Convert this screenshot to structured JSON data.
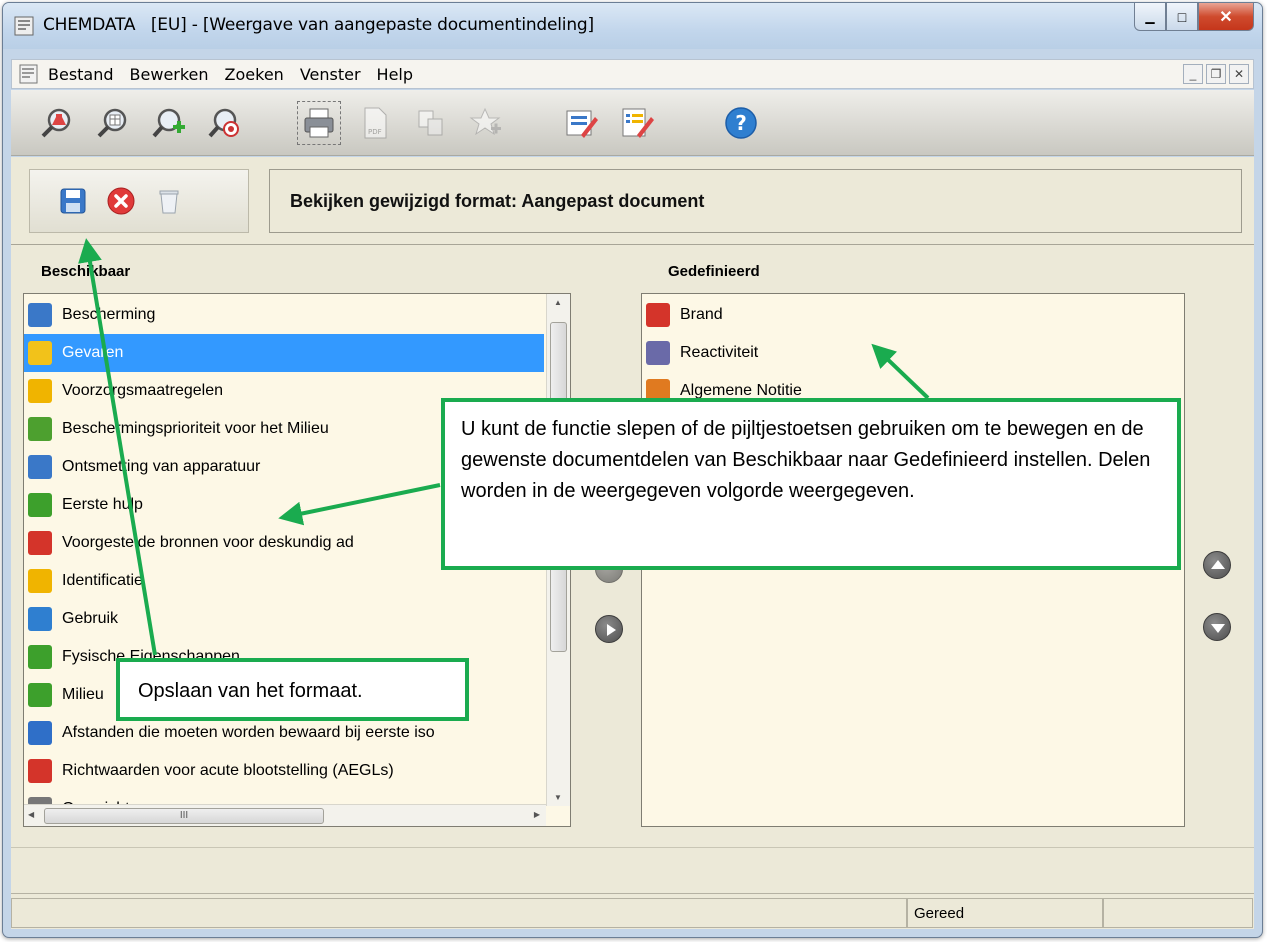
{
  "window": {
    "title": "CHEMDATA   [EU] - [Weergave van aangepaste documentindeling]",
    "minimize_glyph": "▁",
    "maximize_glyph": "□",
    "close_glyph": "✕"
  },
  "menu": {
    "items": [
      "Bestand",
      "Bewerken",
      "Zoeken",
      "Venster",
      "Help"
    ],
    "mdi_min": "_",
    "mdi_restore": "❐",
    "mdi_close": "✕"
  },
  "toolbar": {
    "icons": [
      "search-flask-icon",
      "search-table-icon",
      "search-add-icon",
      "search-target-icon",
      "print-icon",
      "pdf-icon",
      "copy-icon",
      "compare-icon",
      "edit-lock-icon",
      "edit-list-icon",
      "help-icon"
    ],
    "help_glyph": "?"
  },
  "header": {
    "title": "Bekijken gewijzigd format: Aangepast document"
  },
  "available": {
    "title": "Beschikbaar",
    "items": [
      {
        "label": "Bescherming",
        "color": "#3a78c8"
      },
      {
        "label": "Gevaren",
        "color": "#f2c21a"
      },
      {
        "label": "Voorzorgsmaatregelen",
        "color": "#f0b400"
      },
      {
        "label": "Beschermingsprioriteit voor het Milieu",
        "color": "#4da02f"
      },
      {
        "label": "Ontsmetting van apparatuur",
        "color": "#3a78c8"
      },
      {
        "label": "Eerste hulp",
        "color": "#3da02c"
      },
      {
        "label": "Voorgestelde bronnen voor deskundig ad",
        "color": "#d4342a"
      },
      {
        "label": "Identificatie",
        "color": "#f0b400"
      },
      {
        "label": "Gebruik",
        "color": "#2f7fd0"
      },
      {
        "label": "Fysische Eigenschappen",
        "color": "#3da02c"
      },
      {
        "label": "Milieu",
        "color": "#3da02c"
      },
      {
        "label": "Afstanden die moeten worden bewaard bij eerste iso",
        "color": "#2f6fc8"
      },
      {
        "label": "Richtwaarden voor acute blootstelling (AEGLs)",
        "color": "#d4342a"
      },
      {
        "label": "Overzicht",
        "color": "#777777"
      }
    ],
    "selected_index": 1,
    "scroll_thumb_glyph": "III",
    "scroll_up_glyph": "▲",
    "scroll_down_glyph": "▼",
    "scroll_left_glyph": "◀",
    "scroll_right_glyph": "▶"
  },
  "defined": {
    "title": "Gedefinieerd",
    "items": [
      {
        "label": "Brand",
        "color": "#d4342a"
      },
      {
        "label": "Reactiviteit",
        "color": "#6a6aa8"
      },
      {
        "label": "Algemene Notitie",
        "color": "#e07a20"
      }
    ]
  },
  "status": {
    "ready": "Gereed"
  },
  "callouts": {
    "drag_hint": "U kunt de functie slepen of de pijltjestoetsen gebruiken om te bewegen en de gewenste documentdelen van Beschikbaar naar Gedefinieerd instellen. Delen worden in de weergegeven volgorde weergegeven.",
    "save_hint": "Opslaan van het formaat."
  },
  "colors": {
    "accent_green": "#1aab4f",
    "selection_blue": "#3399ff",
    "list_background": "#fdf8e6",
    "panel_background": "#ece9d8"
  }
}
